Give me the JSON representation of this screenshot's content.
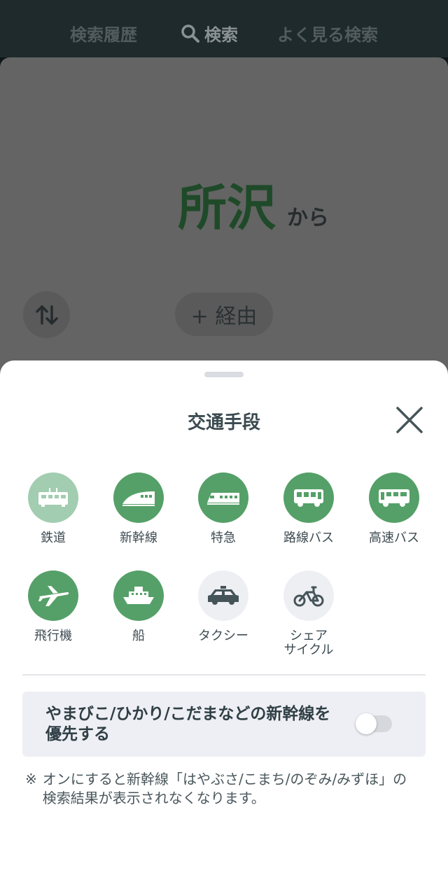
{
  "tabs": {
    "history": "検索履歴",
    "search": "検索",
    "frequent": "よく見る検索"
  },
  "route": {
    "from_station": "所沢",
    "from_suffix": "から",
    "via_label": "+ 経由"
  },
  "sheet": {
    "title": "交通手段",
    "modes": [
      {
        "label": "鉄道",
        "icon": "train-icon",
        "state": "light"
      },
      {
        "label": "新幹線",
        "icon": "shinkansen-icon",
        "state": "on"
      },
      {
        "label": "特急",
        "icon": "limited-express-icon",
        "state": "on"
      },
      {
        "label": "路線バス",
        "icon": "route-bus-icon",
        "state": "on"
      },
      {
        "label": "高速バス",
        "icon": "highway-bus-icon",
        "state": "on"
      },
      {
        "label": "飛行機",
        "icon": "airplane-icon",
        "state": "on"
      },
      {
        "label": "船",
        "icon": "ship-icon",
        "state": "on"
      },
      {
        "label": "タクシー",
        "icon": "taxi-icon",
        "state": "off"
      },
      {
        "label": "シェア\nサイクル",
        "icon": "bicycle-icon",
        "state": "off"
      }
    ],
    "preference": {
      "label": "やまびこ/ひかり/こだまなどの新幹線を優先する",
      "enabled": false
    },
    "note_mark": "※",
    "note": "オンにすると新幹線「はやぶさ/こまち/のぞみ/みずほ」の検索結果が表示されなくなります。"
  },
  "colors": {
    "mode_on": "#55a068",
    "mode_light": "#a2cdb0",
    "mode_off": "#eeeff3",
    "station_text": "#1f4a29"
  }
}
